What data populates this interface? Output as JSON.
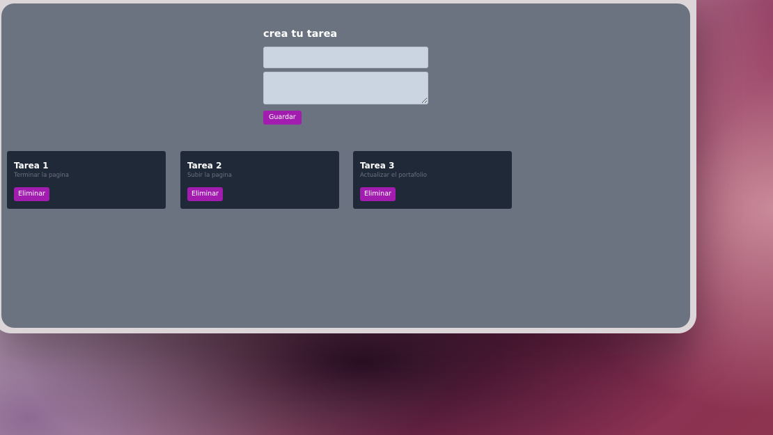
{
  "form": {
    "heading": "crea tu tarea",
    "title_value": "",
    "description_value": "",
    "save_label": "Guardar"
  },
  "tasks": [
    {
      "title": "Tarea 1",
      "description": "Terminar la pagina",
      "delete_label": "Eliminar"
    },
    {
      "title": "Tarea 2",
      "description": "Subir la pagina",
      "delete_label": "Eliminar"
    },
    {
      "title": "Tarea 3",
      "description": "Actualizar el portafolio",
      "delete_label": "Eliminar"
    }
  ],
  "colors": {
    "app_background": "#6b7280",
    "card_background": "#1f2937",
    "accent": "#a21caf",
    "input_background": "#cbd5e1"
  }
}
